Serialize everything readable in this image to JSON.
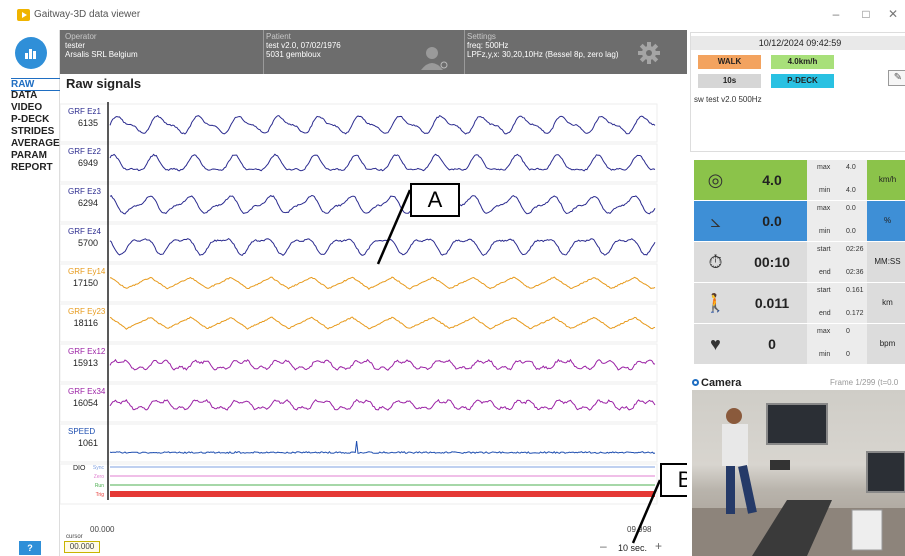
{
  "window": {
    "title": "Gaitway-3D data viewer",
    "minimize": "–",
    "maximize": "□",
    "close": "✕"
  },
  "sidebar": {
    "items": [
      {
        "label": "RAW",
        "active": true
      },
      {
        "label": "DATA"
      },
      {
        "label": "VIDEO"
      },
      {
        "label": "P-DECK"
      },
      {
        "label": "STRIDES"
      },
      {
        "label": "AVERAGE"
      },
      {
        "label": "PARAM"
      },
      {
        "label": "REPORT"
      }
    ],
    "help": "?"
  },
  "header": {
    "operator": {
      "label": "Operator",
      "name": "tester",
      "org": "Arsalis SRL Belgium"
    },
    "patient": {
      "label": "Patient",
      "line1": "test v2.0, 07/02/1976",
      "line2": "5031 gembloux"
    },
    "settings": {
      "label": "Settings",
      "line1": "freq: 500Hz",
      "line2": "LPFz,y,x: 30,20,10Hz (Bessel 8p, zero lag)"
    }
  },
  "page_title": "Raw signals",
  "signals": [
    {
      "name": "GRF Ez1",
      "value": "6135",
      "color": "#2b2b8f"
    },
    {
      "name": "GRF Ez2",
      "value": "6949",
      "color": "#2b2b8f"
    },
    {
      "name": "GRF Ez3",
      "value": "6294",
      "color": "#2b2b8f"
    },
    {
      "name": "GRF Ez4",
      "value": "5700",
      "color": "#2b2b8f"
    },
    {
      "name": "GRF Ey14",
      "value": "17150",
      "color": "#e79a1c"
    },
    {
      "name": "GRF Ey23",
      "value": "18116",
      "color": "#e79a1c"
    },
    {
      "name": "GRF Ex12",
      "value": "15913",
      "color": "#9b22a5"
    },
    {
      "name": "GRF Ex34",
      "value": "16054",
      "color": "#9b22a5"
    },
    {
      "name": "SPEED",
      "value": "1061",
      "color": "#1f4fb0"
    }
  ],
  "dio": {
    "label": "DIO",
    "channels": [
      {
        "name": "Sync",
        "color": "#7fa0e0"
      },
      {
        "name": "Zero",
        "color": "#e07fd0"
      },
      {
        "name": "Run",
        "color": "#4caf50"
      },
      {
        "name": "Trig",
        "color": "#e53935"
      }
    ]
  },
  "cursor": {
    "start": "00.000",
    "label": "cursor",
    "value": "00.000",
    "end": "09.998"
  },
  "window_len": {
    "minus": "–",
    "label": "10 sec.",
    "plus": "+"
  },
  "annotations": {
    "a": "A",
    "b": "B"
  },
  "status": {
    "datetime": "10/12/2024  09:42:59",
    "mode": "WALK",
    "speed": "4.0km/h",
    "duration": "10s",
    "device": "P-DECK",
    "sw": "sw test v2.0 500Hz"
  },
  "metrics": [
    {
      "icon": "speedometer-icon",
      "glyph": "◎",
      "value": "4.0",
      "l1": "max",
      "v1": "4.0",
      "l2": "min",
      "v2": "4.0",
      "unit": "km/h",
      "color": "#8bc34a",
      "unit_color": "#8bc34a"
    },
    {
      "icon": "incline-icon",
      "glyph": "⦣",
      "value": "0.0",
      "l1": "max",
      "v1": "0.0",
      "l2": "min",
      "v2": "0.0",
      "unit": "%",
      "color": "#3e8fd6",
      "unit_color": "#3e8fd6"
    },
    {
      "icon": "timer-icon",
      "glyph": "⏱",
      "value": "00:10",
      "l1": "start",
      "v1": "02:26",
      "l2": "end",
      "v2": "02:36",
      "unit": "MM:SS",
      "color": "#dcdcdc",
      "unit_color": "#dcdcdc"
    },
    {
      "icon": "walker-icon",
      "glyph": "🚶",
      "value": "0.011",
      "l1": "start",
      "v1": "0.161",
      "l2": "end",
      "v2": "0.172",
      "unit": "km",
      "color": "#dcdcdc",
      "unit_color": "#dcdcdc"
    },
    {
      "icon": "heart-icon",
      "glyph": "♥",
      "value": "0",
      "l1": "max",
      "v1": "0",
      "l2": "min",
      "v2": "0",
      "unit": "bpm",
      "color": "#dcdcdc",
      "unit_color": "#dcdcdc"
    }
  ],
  "camera": {
    "title": "Camera",
    "frame": "Frame 1/299 (t=0.0"
  }
}
